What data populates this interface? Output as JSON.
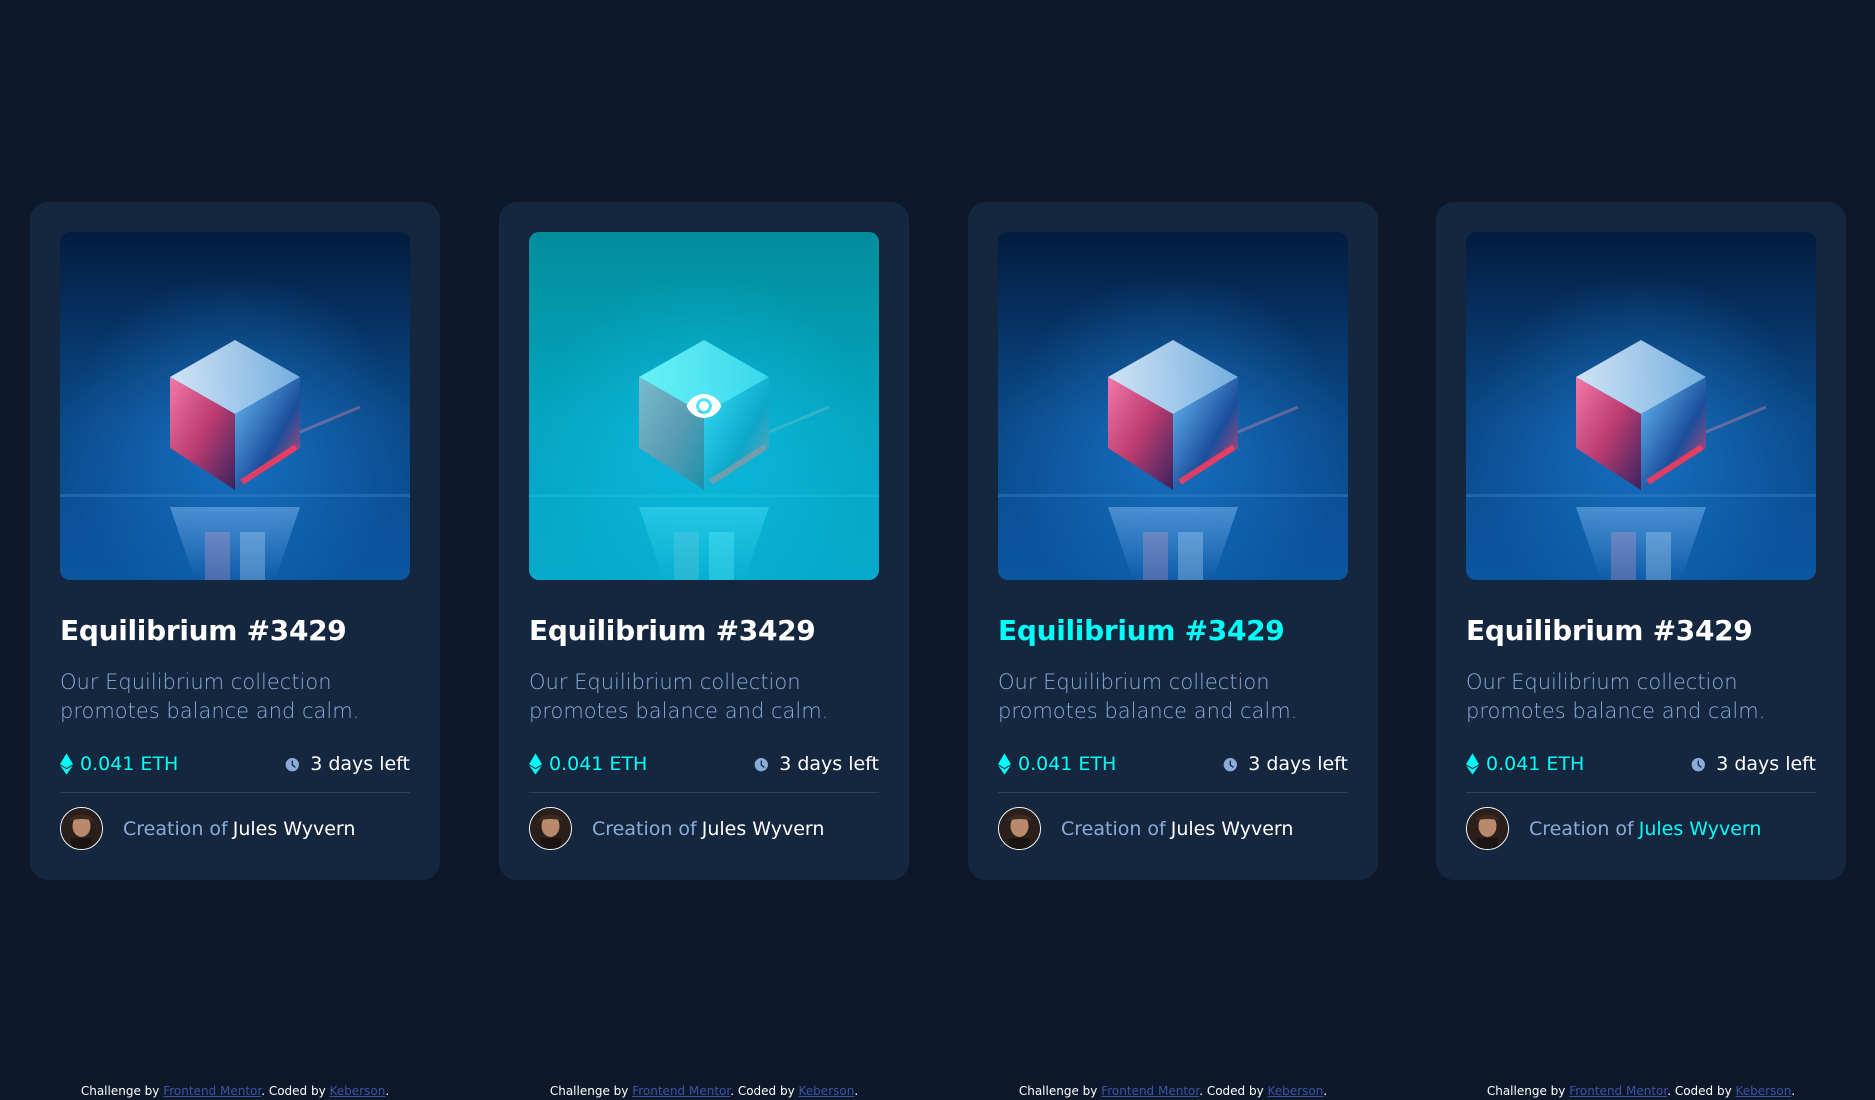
{
  "colors": {
    "page_bg": "#0d192b",
    "card_bg": "#15263f",
    "accent_cyan": "#00fff8",
    "soft_blue": "#8bacd9",
    "link_blue": "#3e52a3"
  },
  "cards": [
    {
      "title": "Equilibrium #3429",
      "description": "Our Equilibrium collection promotes balance and calm.",
      "price": "0.041 ETH",
      "time_left": "3 days left",
      "creator_prefix": "Creation of",
      "creator_name": "Jules Wyvern",
      "state": "default",
      "icons": {
        "price": "ethereum-icon",
        "time": "clock-icon",
        "overlay": "eye-icon"
      }
    },
    {
      "title": "Equilibrium #3429",
      "description": "Our Equilibrium collection promotes balance and calm.",
      "price": "0.041 ETH",
      "time_left": "3 days left",
      "creator_prefix": "Creation of",
      "creator_name": "Jules Wyvern",
      "state": "image-hover",
      "icons": {
        "price": "ethereum-icon",
        "time": "clock-icon",
        "overlay": "eye-icon"
      }
    },
    {
      "title": "Equilibrium #3429",
      "description": "Our Equilibrium collection promotes balance and calm.",
      "price": "0.041 ETH",
      "time_left": "3 days left",
      "creator_prefix": "Creation of",
      "creator_name": "Jules Wyvern",
      "state": "title-hover",
      "icons": {
        "price": "ethereum-icon",
        "time": "clock-icon",
        "overlay": "eye-icon"
      }
    },
    {
      "title": "Equilibrium #3429",
      "description": "Our Equilibrium collection promotes balance and calm.",
      "price": "0.041 ETH",
      "time_left": "3 days left",
      "creator_prefix": "Creation of",
      "creator_name": "Jules Wyvern",
      "state": "creator-hover",
      "icons": {
        "price": "ethereum-icon",
        "time": "clock-icon",
        "overlay": "eye-icon"
      }
    }
  ],
  "footer": {
    "challenge_prefix": "Challenge by",
    "challenge_link": "Frontend Mentor",
    "coded_prefix": ". Coded by",
    "coded_link": "Keberson",
    "suffix": "."
  }
}
